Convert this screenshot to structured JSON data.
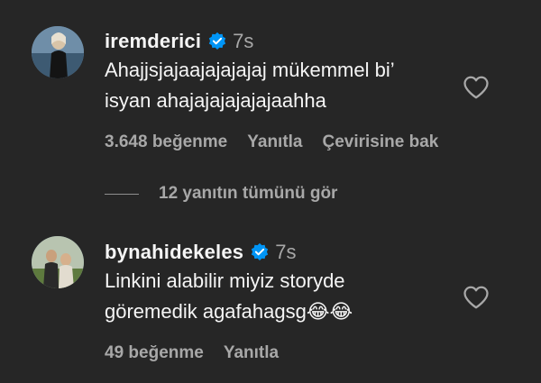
{
  "comments": [
    {
      "username": "iremderici",
      "time": "7s",
      "lines": [
        "Ahajjsjajaajajajajaj mükemmel bi’",
        "isyan ahajajajajajajaahha"
      ],
      "likes": "3.648 beğenme",
      "reply": "Yanıtla",
      "translate": "Çevirisine bak"
    },
    {
      "username": "bynahidekeles",
      "time": "7s",
      "lines": [
        "Linkini alabilir miyiz storyde",
        "göremedik agafahagsg😂😂"
      ],
      "likes": "49 beğenme",
      "reply": "Yanıtla"
    }
  ],
  "view_replies": "12 yanıtın tümünü gör",
  "icons": {
    "verified": "verified-badge-icon",
    "heart": "heart-outline-icon"
  },
  "colors": {
    "background": "#262626",
    "primary_text": "#f5f5f5",
    "secondary_text": "#a8a8a8",
    "verified_blue": "#0095f6"
  }
}
